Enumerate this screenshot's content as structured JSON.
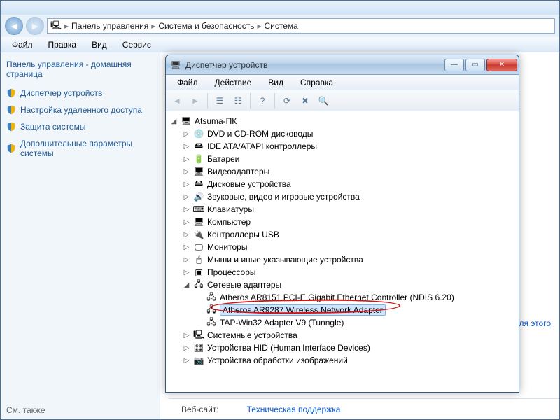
{
  "explorer": {
    "breadcrumb": [
      "Панель управления",
      "Система и безопасность",
      "Система"
    ],
    "menu": [
      "Файл",
      "Правка",
      "Вид",
      "Сервис"
    ],
    "sidebar": {
      "header": "Панель управления - домашняя страница",
      "items": [
        "Диспетчер устройств",
        "Настройка удаленного доступа",
        "Защита системы",
        "Дополнительные параметры системы"
      ],
      "seeAlso": "См. также"
    },
    "status": {
      "label": "Веб-сайт:",
      "link": "Техническая поддержка"
    },
    "contentLink": "и для этого"
  },
  "devmgr": {
    "title": "Диспетчер устройств",
    "menu": [
      "Файл",
      "Действие",
      "Вид",
      "Справка"
    ],
    "root": "Atsuma-ПК",
    "categories": [
      {
        "label": "DVD и CD-ROM дисководы",
        "expanded": false
      },
      {
        "label": "IDE ATA/ATAPI контроллеры",
        "expanded": false
      },
      {
        "label": "Батареи",
        "expanded": false
      },
      {
        "label": "Видеоадаптеры",
        "expanded": false
      },
      {
        "label": "Дисковые устройства",
        "expanded": false
      },
      {
        "label": "Звуковые, видео и игровые устройства",
        "expanded": false
      },
      {
        "label": "Клавиатуры",
        "expanded": false
      },
      {
        "label": "Компьютер",
        "expanded": false
      },
      {
        "label": "Контроллеры USB",
        "expanded": false
      },
      {
        "label": "Мониторы",
        "expanded": false
      },
      {
        "label": "Мыши и иные указывающие устройства",
        "expanded": false
      },
      {
        "label": "Процессоры",
        "expanded": false
      },
      {
        "label": "Сетевые адаптеры",
        "expanded": true,
        "children": [
          {
            "label": "Atheros AR8151 PCI-E Gigabit Ethernet Controller (NDIS 6.20)",
            "selected": false
          },
          {
            "label": "Atheros AR9287 Wireless Network Adapter",
            "selected": true
          },
          {
            "label": "TAP-Win32 Adapter V9 (Tunngle)",
            "selected": false
          }
        ]
      },
      {
        "label": "Системные устройства",
        "expanded": false
      },
      {
        "label": "Устройства HID (Human Interface Devices)",
        "expanded": false
      },
      {
        "label": "Устройства обработки изображений",
        "expanded": false
      }
    ]
  }
}
